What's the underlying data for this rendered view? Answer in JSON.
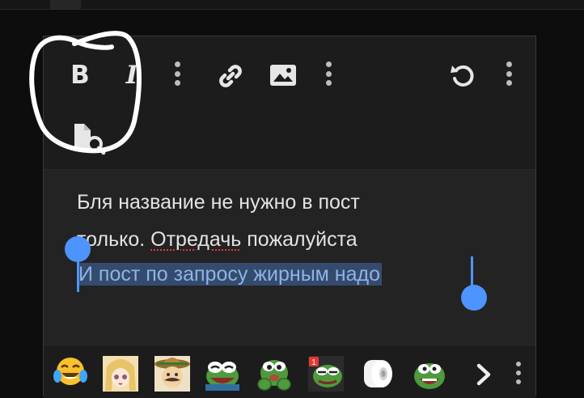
{
  "toolbar": {
    "bold_label": "B",
    "italic_label": "I",
    "icons": [
      "bold-icon",
      "italic-icon",
      "more-vertical-icon",
      "link-icon",
      "image-icon",
      "undo-icon",
      "preview-file-icon"
    ]
  },
  "editor": {
    "lines": [
      {
        "text": "Бля название не нужно в пост"
      },
      {
        "before": "только. ",
        "misspelled": "Отредачь",
        "after": " пожалуйста"
      },
      {
        "selected": "И пост по запросу жирным надо"
      }
    ]
  },
  "emoji_bar": {
    "items": [
      "joy-crying-emoji",
      "anime-girl-emoji",
      "mexican-sombrero-emoji",
      "pepe-laugh-emoji",
      "pepe-hands-emoji",
      "pepe-notification-emoji",
      "toilet-paper-emoji",
      "pepe-scream-emoji"
    ],
    "badge": "1"
  },
  "colors": {
    "background": "#0d0d0d",
    "editor_bg": "#232323",
    "toolbar_bg": "#1c1c1c",
    "selection_bg": "#354b6e",
    "selection_text": "#8fb3e6",
    "handle": "#4d94ff",
    "annotation": "#ffffff"
  }
}
